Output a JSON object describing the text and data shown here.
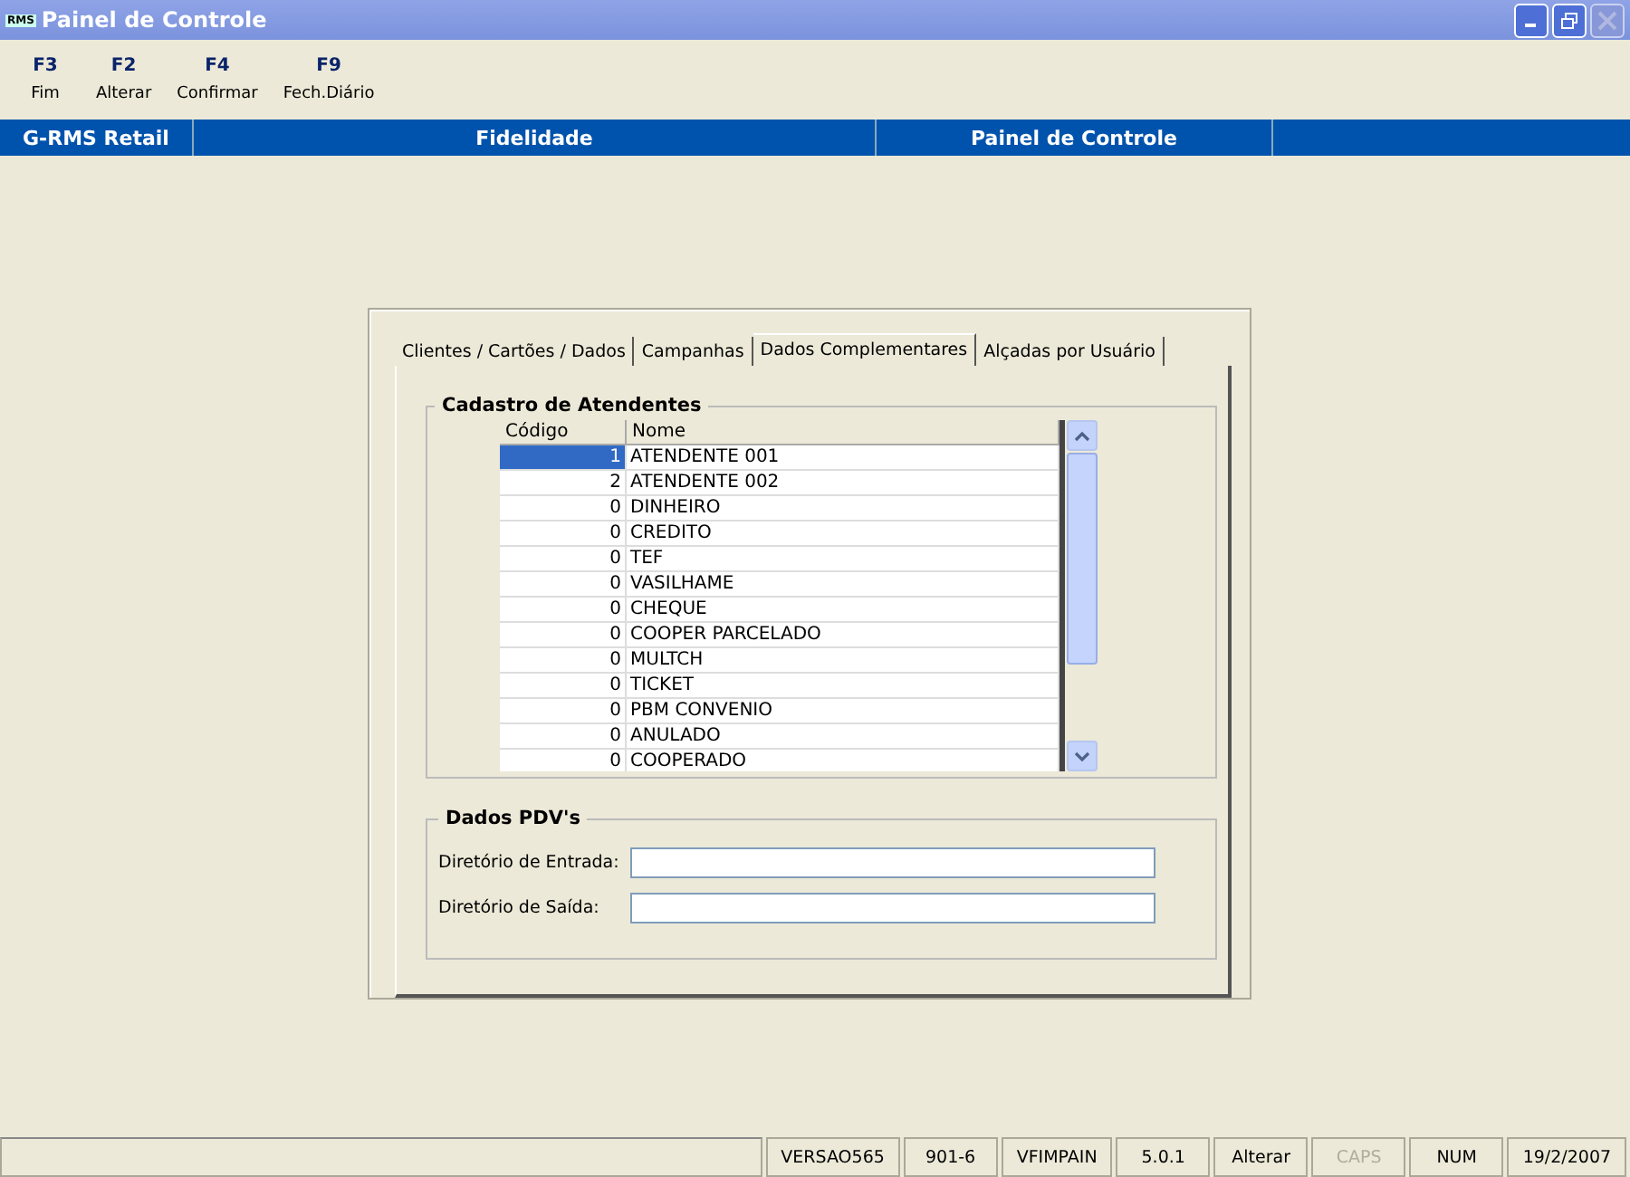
{
  "window": {
    "title": "Painel de Controle",
    "logo": "RMS"
  },
  "toolbar": [
    {
      "key": "F3",
      "label": "Fim"
    },
    {
      "key": "F2",
      "label": "Alterar"
    },
    {
      "key": "F4",
      "label": "Confirmar"
    },
    {
      "key": "F9",
      "label": "Fech.Diário"
    }
  ],
  "header": [
    "G-RMS Retail",
    "Fidelidade",
    "Painel de Controle"
  ],
  "tabs": [
    {
      "label": "Clientes / Cartões / Dados",
      "selected": false
    },
    {
      "label": "Campanhas",
      "selected": false
    },
    {
      "label": "Dados Complementares",
      "selected": true
    },
    {
      "label": "Alçadas por Usuário",
      "selected": false
    }
  ],
  "attendants": {
    "title": "Cadastro de Atendentes",
    "columns": [
      "Código",
      "Nome"
    ],
    "rows": [
      {
        "code": "1",
        "name": "ATENDENTE 001",
        "selected": true
      },
      {
        "code": "2",
        "name": "ATENDENTE 002",
        "selected": false
      },
      {
        "code": "0",
        "name": "DINHEIRO",
        "selected": false
      },
      {
        "code": "0",
        "name": "CREDITO",
        "selected": false
      },
      {
        "code": "0",
        "name": "TEF",
        "selected": false
      },
      {
        "code": "0",
        "name": "VASILHAME",
        "selected": false
      },
      {
        "code": "0",
        "name": "CHEQUE",
        "selected": false
      },
      {
        "code": "0",
        "name": "COOPER PARCELADO",
        "selected": false
      },
      {
        "code": "0",
        "name": "MULTCH",
        "selected": false
      },
      {
        "code": "0",
        "name": "TICKET",
        "selected": false
      },
      {
        "code": "0",
        "name": "PBM CONVENIO",
        "selected": false
      },
      {
        "code": "0",
        "name": "ANULADO",
        "selected": false
      },
      {
        "code": "0",
        "name": "COOPERADO",
        "selected": false
      }
    ]
  },
  "pdv": {
    "title": "Dados PDV's",
    "fields": [
      {
        "label": "Diretório de Entrada:"
      },
      {
        "label": "Diretório de Saída:"
      }
    ]
  },
  "status_bar": [
    {
      "text": "VERSAO565",
      "disabled": false
    },
    {
      "text": "901-6",
      "disabled": false
    },
    {
      "text": "VFIMPAIN",
      "disabled": false
    },
    {
      "text": "5.0.1",
      "disabled": false
    },
    {
      "text": "Alterar",
      "disabled": false
    },
    {
      "text": "CAPS",
      "disabled": true
    },
    {
      "text": "NUM",
      "disabled": false
    },
    {
      "text": "19/2/2007",
      "disabled": false
    }
  ]
}
